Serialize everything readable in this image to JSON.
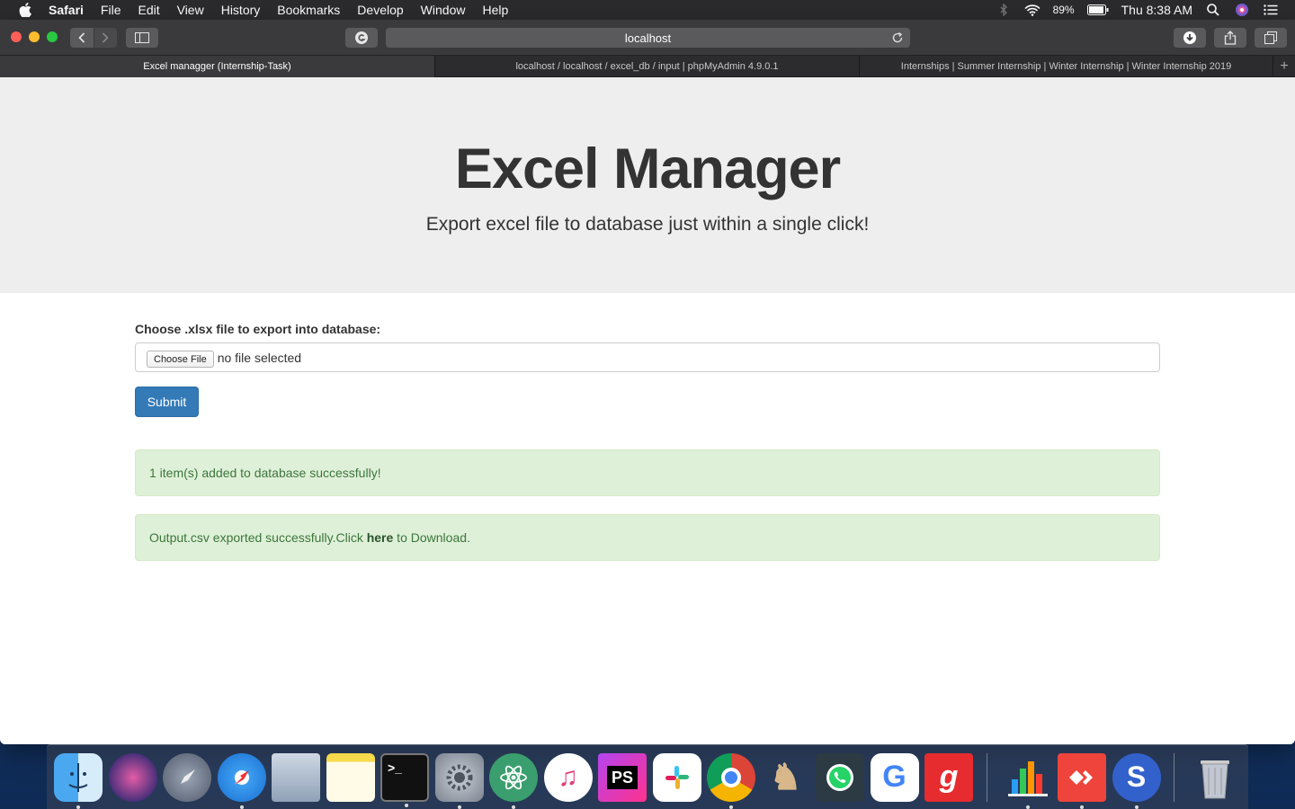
{
  "menubar": {
    "app_name": "Safari",
    "items": [
      "File",
      "Edit",
      "View",
      "History",
      "Bookmarks",
      "Develop",
      "Window",
      "Help"
    ],
    "battery": "89%",
    "clock": "Thu 8:38 AM"
  },
  "browser": {
    "address": "localhost",
    "tabs": [
      {
        "title": "Excel managger (Internship-Task)",
        "active": true
      },
      {
        "title": "localhost / localhost / excel_db / input | phpMyAdmin 4.9.0.1",
        "active": false
      },
      {
        "title": "Internships | Summer Internship | Winter Internship | Winter Internship 2019",
        "active": false
      }
    ],
    "new_tab_glyph": "+"
  },
  "page": {
    "title": "Excel Manager",
    "subtitle": "Export excel file to database just within a single click!",
    "file_label": "Choose .xlsx file to export into database:",
    "choose_file_button": "Choose File",
    "file_status": "no file selected",
    "submit_label": "Submit",
    "alert_added": "1 item(s) added to database successfully!",
    "alert_export_prefix": "Output.csv exported successfully.Click ",
    "alert_export_link": "here",
    "alert_export_suffix": " to Download."
  },
  "dock": {
    "apps": [
      "finder-icon",
      "siri-icon",
      "launchpad-icon",
      "safari-icon",
      "mail-icon",
      "notes-icon",
      "terminal-icon",
      "system-preferences-icon",
      "atom-icon",
      "itunes-icon",
      "phpstorm-icon",
      "slack-icon",
      "chrome-icon",
      "chess-icon",
      "whatsapp-icon",
      "google-icon",
      "gaana-icon",
      "numbers-icon",
      "anydesk-icon",
      "simplenote-icon",
      "trash-icon"
    ],
    "colors": {
      "accent": "#337ab7",
      "alert_bg": "#dff0d8",
      "alert_text": "#3c763d",
      "jumbotron_bg": "#eeeeee"
    }
  }
}
